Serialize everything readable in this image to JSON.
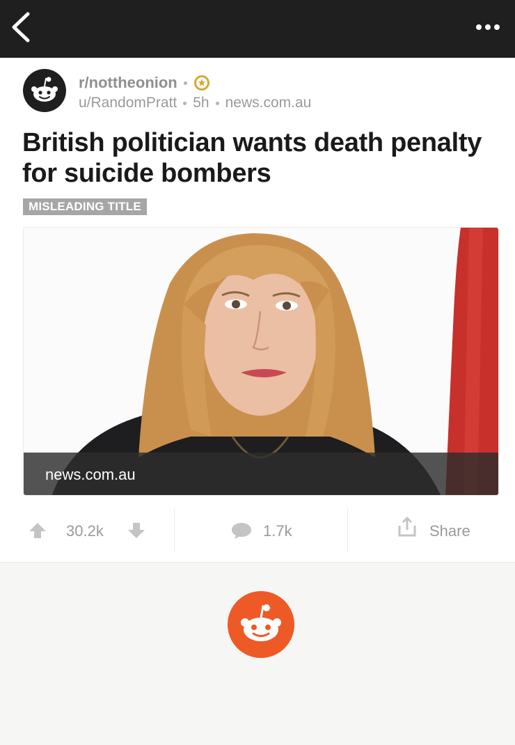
{
  "header": {
    "back_icon": "chevron-left-icon",
    "more_icon": "more-horizontal-icon",
    "background": "#1f1f1f"
  },
  "post": {
    "subreddit": "r/nottheonion",
    "author": "u/RandomPratt",
    "age": "5h",
    "domain": "news.com.au",
    "title": "British politician wants death penalty for suicide bombers",
    "flair": "MISLEADING TITLE",
    "thumbnail_caption": "news.com.au",
    "awards": [
      "gold-award-icon"
    ]
  },
  "actions": {
    "score": "30.2k",
    "comments": "1.7k",
    "share_label": "Share"
  },
  "colors": {
    "accent_orange": "#ee5a26",
    "gold": "#d6a834",
    "text_muted": "#9a9a9a",
    "flair_bg": "#a6a6a6"
  }
}
